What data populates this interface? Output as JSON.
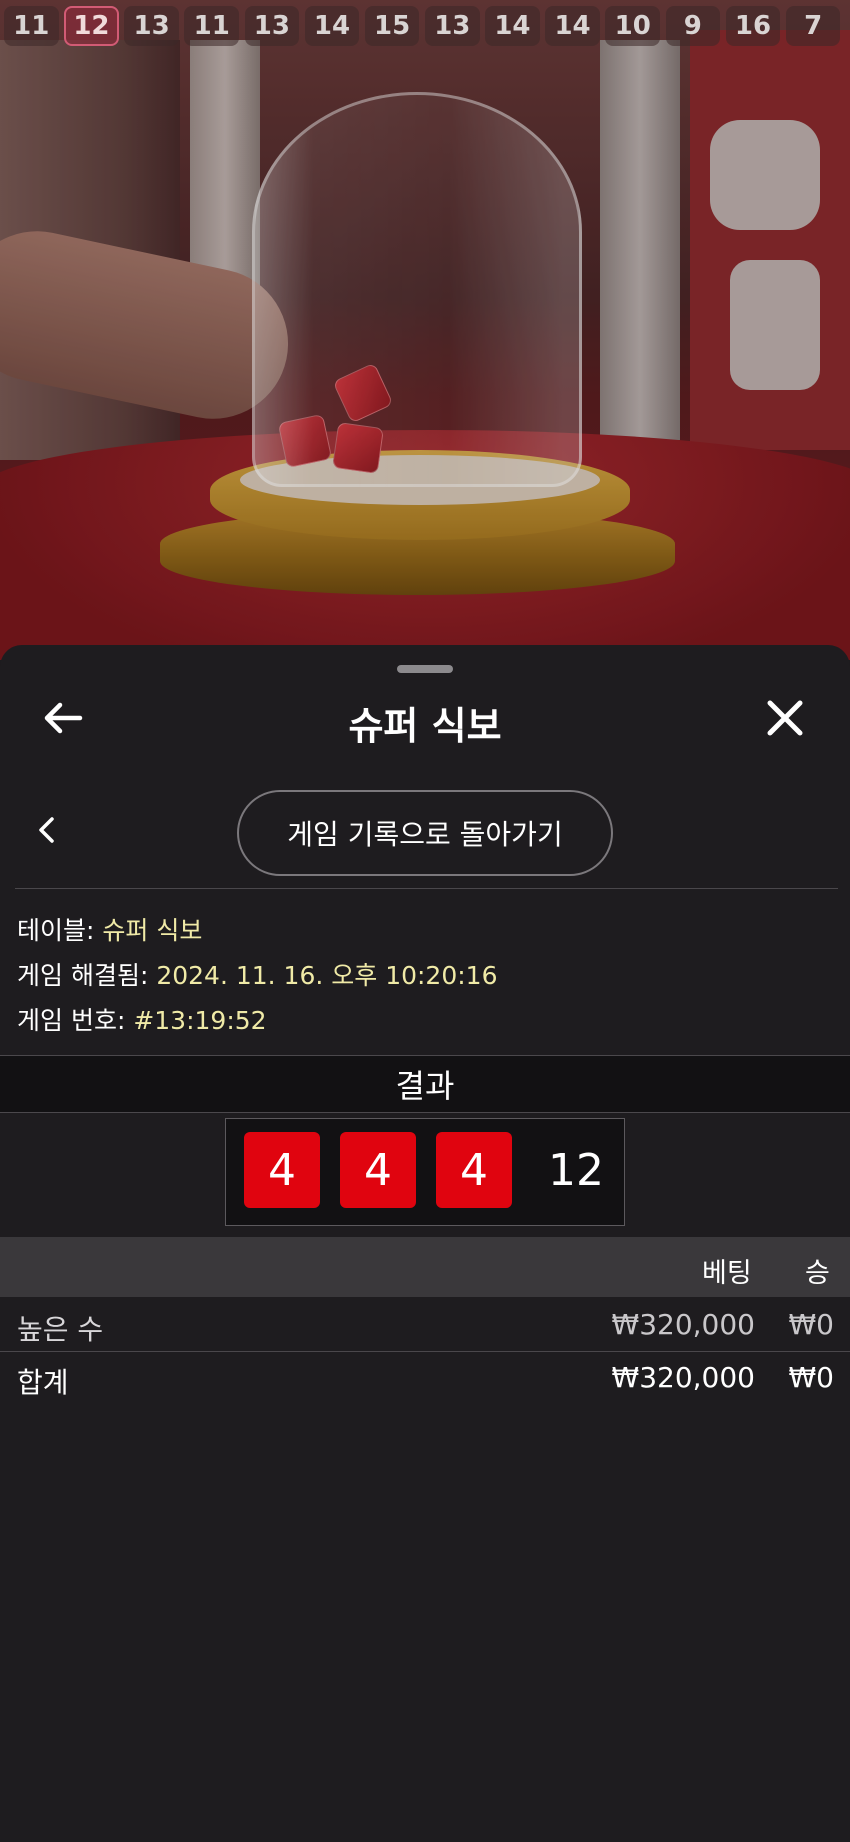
{
  "history": [
    "11",
    "12",
    "13",
    "11",
    "13",
    "14",
    "15",
    "13",
    "14",
    "14",
    "10",
    "9",
    "16",
    "7"
  ],
  "history_highlight_index": 1,
  "sheet": {
    "title": "슈퍼 식보",
    "back_to_history": "게임 기록으로 돌아가기"
  },
  "info": {
    "table_label": "테이블: ",
    "table_value": "슈퍼 식보",
    "resolved_label": "게임 해결됨: ",
    "resolved_value": "2024. 11. 16. 오후 10:20:16",
    "number_label": "게임 번호: ",
    "number_value": "#13:19:52"
  },
  "result": {
    "heading": "결과",
    "dice": [
      "4",
      "4",
      "4"
    ],
    "total": "12"
  },
  "bets": {
    "col_bet": "베팅",
    "col_win": "승",
    "rows": [
      {
        "name": "높은 수",
        "bet": "₩320,000",
        "win": "₩0"
      }
    ],
    "total": {
      "name": "합계",
      "bet": "₩320,000",
      "win": "₩0"
    }
  },
  "colors": {
    "dice_red": "#e0040f",
    "info_value": "#f0eaa7",
    "sheet_bg": "#1e1c1f",
    "history_highlight": "#d25b75"
  }
}
